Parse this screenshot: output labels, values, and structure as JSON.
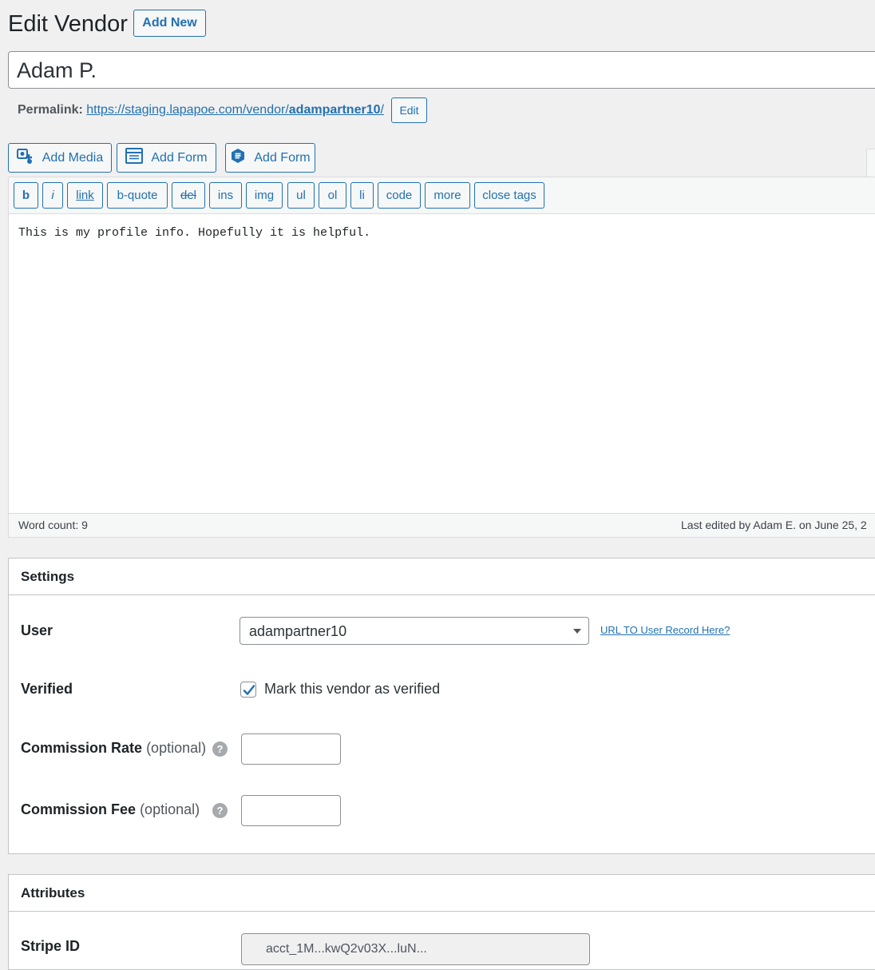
{
  "header": {
    "title": "Edit Vendor",
    "add_new_label": "Add New"
  },
  "post_title": {
    "value": "Adam P."
  },
  "permalink": {
    "label": "Permalink:",
    "url_prefix": "https://staging.lapapoe.com/vendor/",
    "slug": "adampartner10",
    "url_suffix": "/",
    "edit_label": "Edit"
  },
  "media_buttons": [
    {
      "label": "Add Media",
      "icon": "add-media-icon"
    },
    {
      "label": "Add Form",
      "icon": "form-icon"
    },
    {
      "label": "Add Form",
      "icon": "gravity-form-icon"
    }
  ],
  "quicktags": [
    "b",
    "i",
    "link",
    "b-quote",
    "del",
    "ins",
    "img",
    "ul",
    "ol",
    "li",
    "code",
    "more",
    "close tags"
  ],
  "editor": {
    "content": "This is my profile info. Hopefully it is helpful.",
    "word_count": "Word count: 9",
    "last_edited": "Last edited by Adam E. on June 25, 2"
  },
  "settings": {
    "title": "Settings",
    "user_label": "User",
    "user_value": "adampartner10",
    "user_link": "URL TO User Record Here?",
    "verified_label": "Verified",
    "verified_checkbox_label": "Mark this vendor as verified",
    "verified_checked": true,
    "commission_rate_label": "Commission Rate",
    "commission_fee_label": "Commission Fee",
    "optional_text": "(optional)",
    "help_glyph": "?"
  },
  "attributes": {
    "title": "Attributes",
    "stripe_label": "Stripe ID",
    "stripe_value": "acct_1M...kwQ2v03X...luN..."
  },
  "colors": {
    "accent": "#2271b1",
    "background": "#f0f0f1",
    "panel": "#ffffff"
  }
}
